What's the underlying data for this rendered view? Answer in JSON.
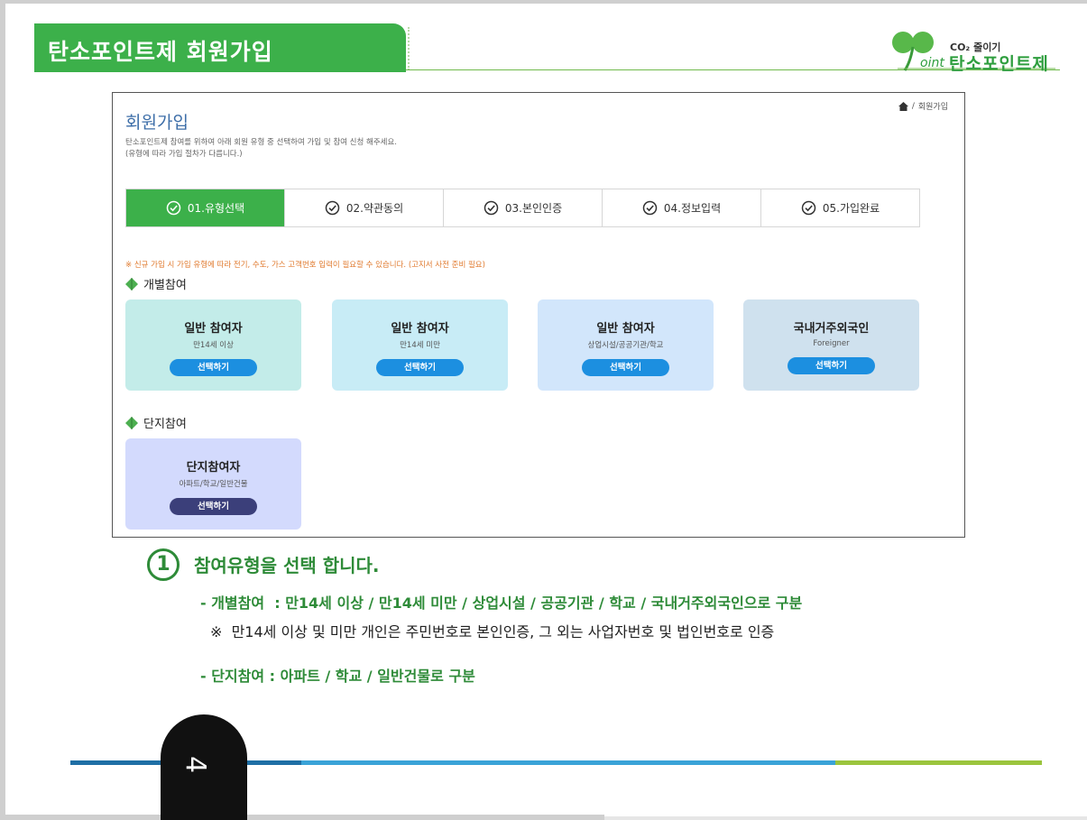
{
  "header": {
    "title": "탄소포인트제 회원가입",
    "logo_co2": "CO₂ 줄이기",
    "logo_name": "탄소포인트제",
    "logo_oint": "oint"
  },
  "screen": {
    "breadcrumb": "회원가입",
    "heading": "회원가입",
    "desc_line1": "탄소포인트제 참여를 위하여 아래 회원 유형 중 선택하여 가입 및 참여 신청 해주세요.",
    "desc_line2": "(유형에 따라 가입 절차가 다릅니다.)",
    "steps": [
      {
        "label": "01.유형선택",
        "active": true
      },
      {
        "label": "02.약관동의",
        "active": false
      },
      {
        "label": "03.본인인증",
        "active": false
      },
      {
        "label": "04.정보입력",
        "active": false
      },
      {
        "label": "05.가입완료",
        "active": false
      }
    ],
    "notice": "※ 신규 가입 시 가입 유형에 따라 전기, 수도, 가스 고객번호 입력이 필요할 수 있습니다. (고지서 사전 준비 필요)",
    "section_individual": "개별참여",
    "section_complex": "단지참여",
    "cards": [
      {
        "title": "일반 참여자",
        "sub": "만14세 이상",
        "button": "선택하기",
        "bg": "#c3ece9"
      },
      {
        "title": "일반 참여자",
        "sub": "만14세 미만",
        "button": "선택하기",
        "bg": "#c8ecf6"
      },
      {
        "title": "일반 참여자",
        "sub": "상업시설/공공기관/학교",
        "button": "선택하기",
        "bg": "#d2e6fb"
      },
      {
        "title": "국내거주외국인",
        "sub": "Foreigner",
        "button": "선택하기",
        "bg": "#cfe1ee"
      }
    ],
    "complex_card": {
      "title": "단지참여자",
      "sub": "아파트/학교/일반건물",
      "button": "선택하기",
      "bg": "#d3dafd"
    }
  },
  "explain": {
    "number": "1",
    "title": "참여유형을 선택 합니다.",
    "line_individual": "- 개별참여  : 만14세 이상 / 만14세 미만 / 상업시설 / 공공기관 / 학교 / 국내거주외국인으로 구분",
    "line_note": "※  만14세 이상 및 미만 개인은 주민번호로 본인인증, 그 외는 사업자번호 및 법인번호로 인증",
    "line_complex": "- 단지참여 : 아파트 / 학교 / 일반건물로 구분"
  },
  "footer": {
    "page_number": "4"
  }
}
